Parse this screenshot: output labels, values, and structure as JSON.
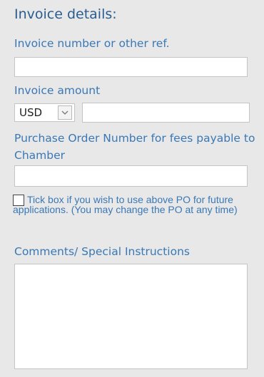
{
  "section": {
    "title": "Invoice details:"
  },
  "fields": {
    "invoice_ref_label": "Invoice number or other ref.",
    "invoice_ref_value": "",
    "amount_label": "Invoice amount",
    "currency_selected": "USD",
    "amount_value": "",
    "po_label": "Purchase Order Number for fees payable to Chamber",
    "po_value": "",
    "po_checkbox_checked": false,
    "po_checkbox_text": "Tick box if you wish to use above PO for future applications. (You may change the PO at any time)",
    "comments_label": "Comments/ Special Instructions",
    "comments_value": ""
  },
  "icons": {
    "dropdown": "chevron-down-icon"
  },
  "colors": {
    "background": "#e8e8e8",
    "heading": "#2a5d8f",
    "label": "#3a78b5"
  }
}
